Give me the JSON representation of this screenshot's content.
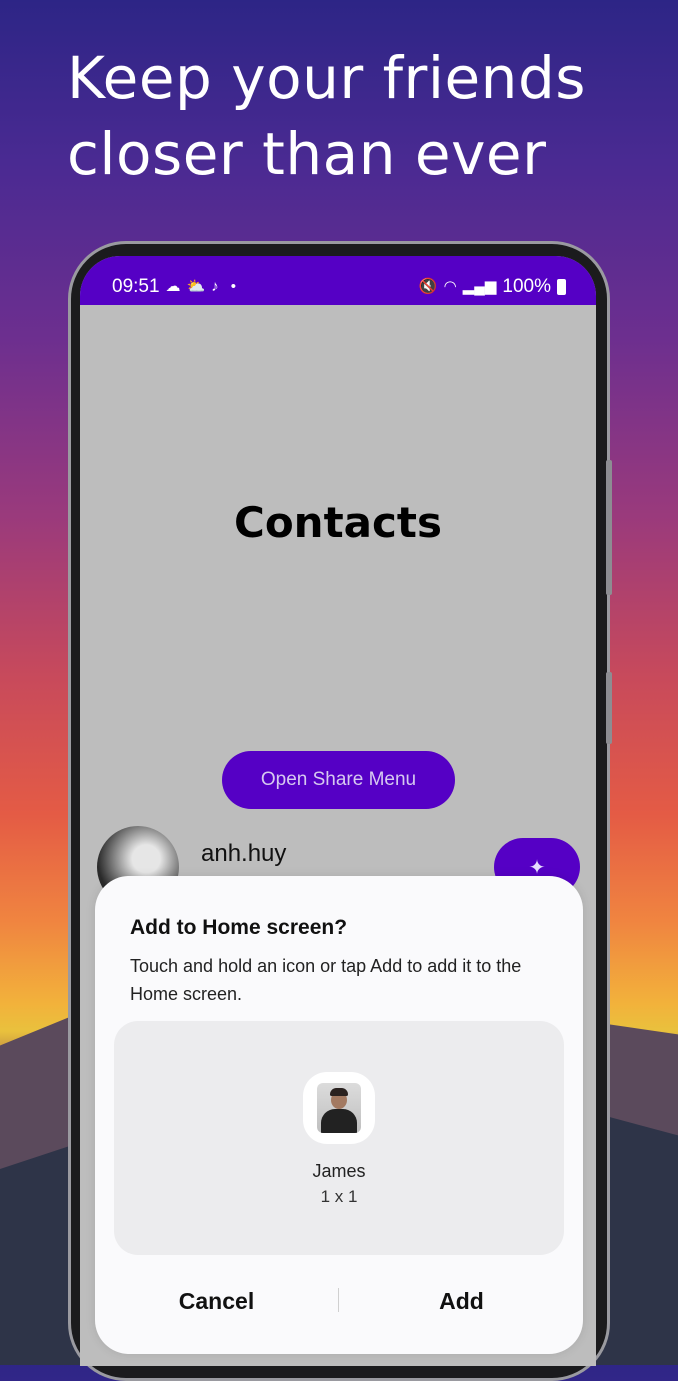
{
  "headline": {
    "line1": "Keep your friends",
    "line2": "closer than ever"
  },
  "status_bar": {
    "time": "09:51",
    "left_icons": [
      "cloud-icon",
      "weather-icon",
      "tiktok-icon",
      "dot-icon"
    ],
    "right_icons": [
      "mute-icon",
      "wifi-icon",
      "signal-icon"
    ],
    "battery": "100%"
  },
  "screen": {
    "title": "Contacts",
    "share_button": "Open Share Menu",
    "contact": {
      "name": "anh.huy"
    }
  },
  "dialog": {
    "title": "Add to Home screen?",
    "body": "Touch and hold an icon or tap Add to add it to the Home screen.",
    "app_name": "James",
    "app_size": "1 x 1",
    "cancel_label": "Cancel",
    "add_label": "Add"
  },
  "colors": {
    "accent": "#5500c5",
    "screen_bg": "#bdbdbd",
    "dialog_bg": "#fafafc"
  }
}
